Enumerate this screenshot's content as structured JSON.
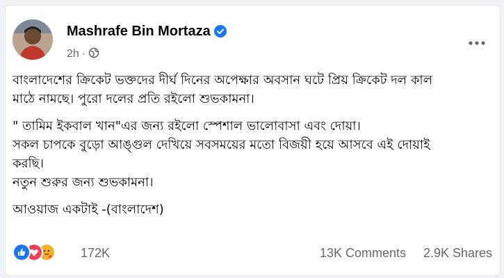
{
  "post": {
    "author": "Mashrafe Bin Mortaza",
    "time": "2h",
    "paragraphs": [
      [
        "বাংলাদেশের ক্রিকেট ভক্তদের দীর্ঘ দিনের অপেক্ষার অবসান ঘটে প্রিয় ক্রিকেট দল কাল",
        "মাঠে নামছে। পুরো দলের প্রতি রইলো শুভকামনা।"
      ],
      [
        "\" তামিম ইকবাল খান\"এর  জন্য রইলো স্পেশাল ভালোবাসা এবং দোয়া।",
        "সকল চাপকে বুড়ো আঙ্গুল দেখিয়ে সবসময়ের মতো বিজয়ী হয়ে আসবে এই দোয়াই",
        "করছি।",
        "নতুন শুরুর জন্য শুভকামনা।"
      ],
      [
        "আওয়াজ একটাই -(বাংলাদেশ)"
      ]
    ],
    "reactions_count": "172K",
    "comments_label": "13K Comments",
    "shares_label": "2.9K Shares"
  },
  "icons": {
    "verified": "verified-badge-icon",
    "privacy": "globe-icon",
    "more": "more-options-icon",
    "like": "like-reaction-icon",
    "love": "love-reaction-icon",
    "care": "care-reaction-icon"
  },
  "colors": {
    "verified": "#1877f2",
    "like": "#1877f2",
    "love": "#f33e58",
    "care": "#f7b125",
    "secondary_text": "#65676b"
  }
}
